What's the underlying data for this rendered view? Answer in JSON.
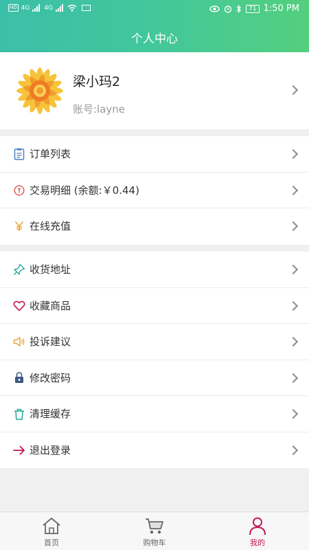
{
  "status_bar": {
    "time": "1:50 PM",
    "battery": "71",
    "network_left": "4G",
    "network_right": "4G",
    "hd_badge": "HD"
  },
  "header": {
    "title": "个人中心"
  },
  "profile": {
    "name": "梁小玛2",
    "account": "账号:layne"
  },
  "menu_group_1": [
    {
      "label": "订单列表",
      "icon": "order-list-icon",
      "color": "#4a7fc1"
    },
    {
      "label": "交易明细 (余额:￥0.44)",
      "icon": "transaction-icon",
      "color": "#d9534f"
    },
    {
      "label": "在线充值",
      "icon": "yen-icon",
      "color": "#e6a23c"
    }
  ],
  "menu_group_2": [
    {
      "label": "收货地址",
      "icon": "pin-icon",
      "color": "#26a69a"
    },
    {
      "label": "收藏商品",
      "icon": "heart-icon",
      "color": "#c2185b"
    },
    {
      "label": "投诉建议",
      "icon": "speaker-icon",
      "color": "#e6a23c"
    },
    {
      "label": "修改密码",
      "icon": "lock-icon",
      "color": "#3d5a80"
    },
    {
      "label": "清理缓存",
      "icon": "trash-icon",
      "color": "#26a69a"
    },
    {
      "label": "退出登录",
      "icon": "logout-arrow-icon",
      "color": "#c2185b"
    }
  ],
  "tabbar": [
    {
      "label": "首页",
      "icon": "home-icon"
    },
    {
      "label": "购物车",
      "icon": "cart-icon"
    },
    {
      "label": "我的",
      "icon": "person-icon",
      "active": true
    }
  ],
  "colors": {
    "accent": "#c2185b",
    "header_start": "#3bbfa8",
    "header_end": "#54cf7e"
  }
}
